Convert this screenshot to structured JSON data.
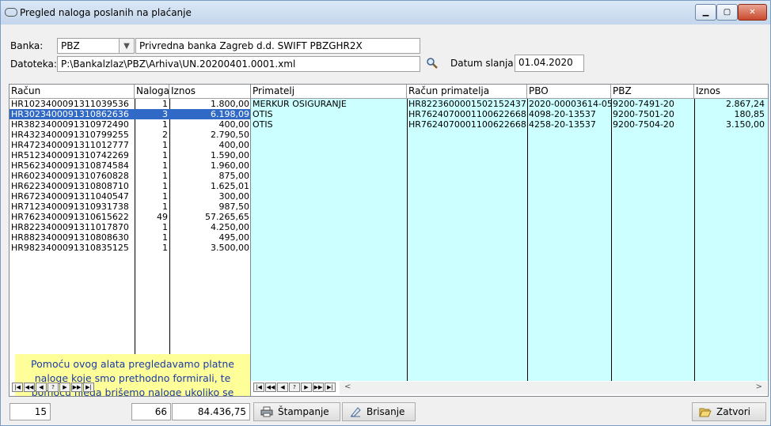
{
  "window": {
    "title": "Pregled naloga poslanih na plaćanje"
  },
  "form": {
    "banka_label": "Banka:",
    "banka_code": "PBZ",
    "banka_name": "Privredna banka Zagreb d.d. SWIFT PBZGHR2X",
    "datoteka_label": "Datoteka:",
    "datoteka_value": "P:\\Bankalzlaz\\PBZ\\Arhiva\\UN.20200401.0001.xml",
    "datum_label": "Datum slanja:",
    "datum_value": "01.04.2020"
  },
  "left_grid": {
    "columns": [
      "Račun",
      "Naloga",
      "Iznos"
    ],
    "rows": [
      {
        "racun": "HR1023400091311039536",
        "naloga": "1",
        "iznos": "1.800,00"
      },
      {
        "racun": "HR3023400091310862636",
        "naloga": "3",
        "iznos": "6.198,09",
        "selected": true
      },
      {
        "racun": "HR3823400091310972490",
        "naloga": "1",
        "iznos": "400,00"
      },
      {
        "racun": "HR4323400091310799255",
        "naloga": "2",
        "iznos": "2.790,50"
      },
      {
        "racun": "HR4723400091311012777",
        "naloga": "1",
        "iznos": "400,00"
      },
      {
        "racun": "HR5123400091310742269",
        "naloga": "1",
        "iznos": "1.590,00"
      },
      {
        "racun": "HR5623400091310874584",
        "naloga": "1",
        "iznos": "1.960,00"
      },
      {
        "racun": "HR6023400091310760828",
        "naloga": "1",
        "iznos": "875,00"
      },
      {
        "racun": "HR6223400091310808710",
        "naloga": "1",
        "iznos": "1.625,01"
      },
      {
        "racun": "HR6723400091311040547",
        "naloga": "1",
        "iznos": "300,00"
      },
      {
        "racun": "HR7123400091310931738",
        "naloga": "1",
        "iznos": "987,50"
      },
      {
        "racun": "HR7623400091310615622",
        "naloga": "49",
        "iznos": "57.265,65"
      },
      {
        "racun": "HR8223400091311017870",
        "naloga": "1",
        "iznos": "4.250,00"
      },
      {
        "racun": "HR8823400091310808630",
        "naloga": "1",
        "iznos": "495,00"
      },
      {
        "racun": "HR9823400091310835125",
        "naloga": "1",
        "iznos": "3.500,00"
      }
    ]
  },
  "right_grid": {
    "columns": [
      "Primatelj",
      "Račun primatelja",
      "PBO",
      "PBZ",
      "Iznos"
    ],
    "rows": [
      {
        "primatelj": "MERKUR OSIGURANJE",
        "racun": "HR8223600001502152437",
        "pbo": "2020-00003614-05(",
        "pbz": "9200-7491-20",
        "iznos": "2.867,24"
      },
      {
        "primatelj": "OTIS",
        "racun": "HR7624070001100622668",
        "pbo": "4098-20-13537",
        "pbz": "9200-7501-20",
        "iznos": "180,85"
      },
      {
        "primatelj": "OTIS",
        "racun": "HR7624070001100622668",
        "pbo": "4258-20-13537",
        "pbz": "9200-7504-20",
        "iznos": "3.150,00"
      }
    ]
  },
  "note": "Pomoću ovog alata pregledavamo platne naloge koje smo prethodno formirali, te pomoću njega brišemo naloge ukoliko se potkrala kakva greška - npr krivi broj žiro računa poslovnog partnera ili slično",
  "footer": {
    "count": "15",
    "naloga_total": "66",
    "iznos_total": "84.436,75"
  },
  "buttons": {
    "print": "Štampanje",
    "delete": "Brisanje",
    "close": "Zatvori"
  }
}
